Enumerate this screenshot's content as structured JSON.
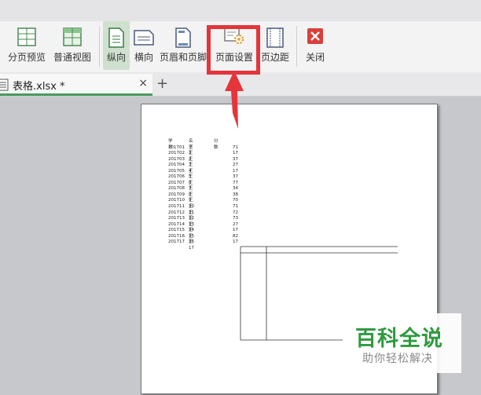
{
  "ribbon": {
    "buttons": [
      {
        "label": "分页预览",
        "icon": "page-break-preview-icon"
      },
      {
        "label": "普通视图",
        "icon": "normal-view-icon"
      },
      {
        "label": "纵向",
        "icon": "portrait-icon",
        "active": true
      },
      {
        "label": "横向",
        "icon": "landscape-icon"
      },
      {
        "label": "页眉和页脚",
        "icon": "header-footer-icon"
      },
      {
        "label": "页面设置",
        "icon": "page-setup-icon",
        "highlighted": true
      },
      {
        "label": "页边距",
        "icon": "margins-icon"
      },
      {
        "label": "关闭",
        "icon": "close-icon"
      }
    ]
  },
  "tab": {
    "filename": "表格.xlsx *",
    "close": "×",
    "new_tab": "+"
  },
  "sheet": {
    "headers": [
      "学号",
      "名字",
      "分数"
    ],
    "rows": [
      [
        "201701",
        "王1",
        "71"
      ],
      [
        "201702",
        "王2",
        "17"
      ],
      [
        "201703",
        "王3",
        "37"
      ],
      [
        "201704",
        "王4",
        "27"
      ],
      [
        "201705",
        "王5",
        "17"
      ],
      [
        "201706",
        "王6",
        "37"
      ],
      [
        "201707",
        "王7",
        "77"
      ],
      [
        "201708",
        "王8",
        "34"
      ],
      [
        "201709",
        "王9",
        "38"
      ],
      [
        "201710",
        "王10",
        "70"
      ],
      [
        "201711",
        "王11",
        "71"
      ],
      [
        "201712",
        "王12",
        "72"
      ],
      [
        "201713",
        "王13",
        "73"
      ],
      [
        "201714",
        "王14",
        "27"
      ],
      [
        "201715",
        "王15",
        "17"
      ],
      [
        "201716",
        "王16",
        "82"
      ],
      [
        "201717",
        "王17",
        "17"
      ]
    ]
  },
  "watermark": {
    "title": "百科全说",
    "subtitle": "助你轻松解决"
  },
  "colors": {
    "highlight": "#e4353a",
    "accent": "#4a9a5c",
    "watermark": "#2f9a3f"
  }
}
